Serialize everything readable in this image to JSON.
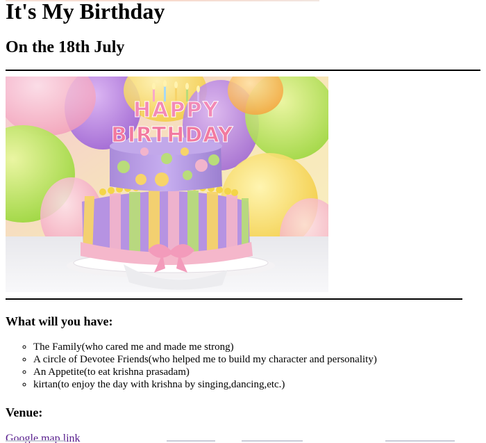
{
  "page": {
    "title": "It's My Birthday",
    "date_heading": "On the 18th July"
  },
  "image": {
    "cake_top_text": "HAPPY",
    "cake_bottom_text": "BIRTHDAY"
  },
  "what_to_have": {
    "heading": "What will you have:",
    "items": [
      "The Family(who cared me and made me strong)",
      "A circle of Devotee Friends(who helped me to build my character and personality)",
      "An Appetite(to eat krishna prasadam)",
      "kirtan(to enjoy the day with krishna by singing,dancing,etc.)"
    ]
  },
  "venue": {
    "heading": "Venue:",
    "link_text": "Google map link"
  },
  "colors": {
    "text": "#000000",
    "link_visited": "#551a8b",
    "background": "#ffffff"
  }
}
